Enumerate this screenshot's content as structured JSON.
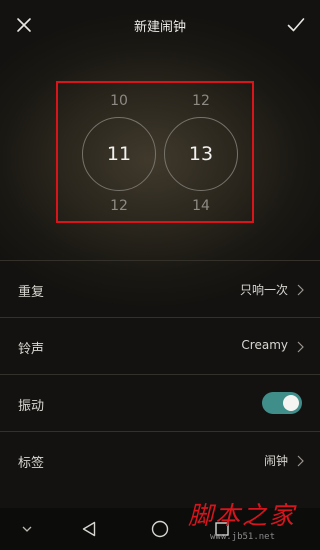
{
  "header": {
    "title": "新建闹钟",
    "close_icon": "close-icon",
    "confirm_icon": "check-icon"
  },
  "time_picker": {
    "hours": {
      "prev": "10",
      "selected": "11",
      "next": "12"
    },
    "minutes": {
      "prev": "12",
      "selected": "13",
      "next": "14"
    },
    "highlight_color": "#d9141b"
  },
  "settings": {
    "repeat": {
      "label": "重复",
      "value": "只响一次"
    },
    "ringtone": {
      "label": "铃声",
      "value": "Creamy"
    },
    "vibrate": {
      "label": "振动",
      "enabled": true
    },
    "tag": {
      "label": "标签",
      "value": "闹钟"
    }
  },
  "accent_color": "#3f8e8a",
  "navbar": {
    "icons": [
      "chevron-down-icon",
      "back-triangle-icon",
      "home-circle-icon",
      "recent-square-icon"
    ]
  },
  "watermark": {
    "text": "脚本之家",
    "url": "www.jb51.net"
  }
}
